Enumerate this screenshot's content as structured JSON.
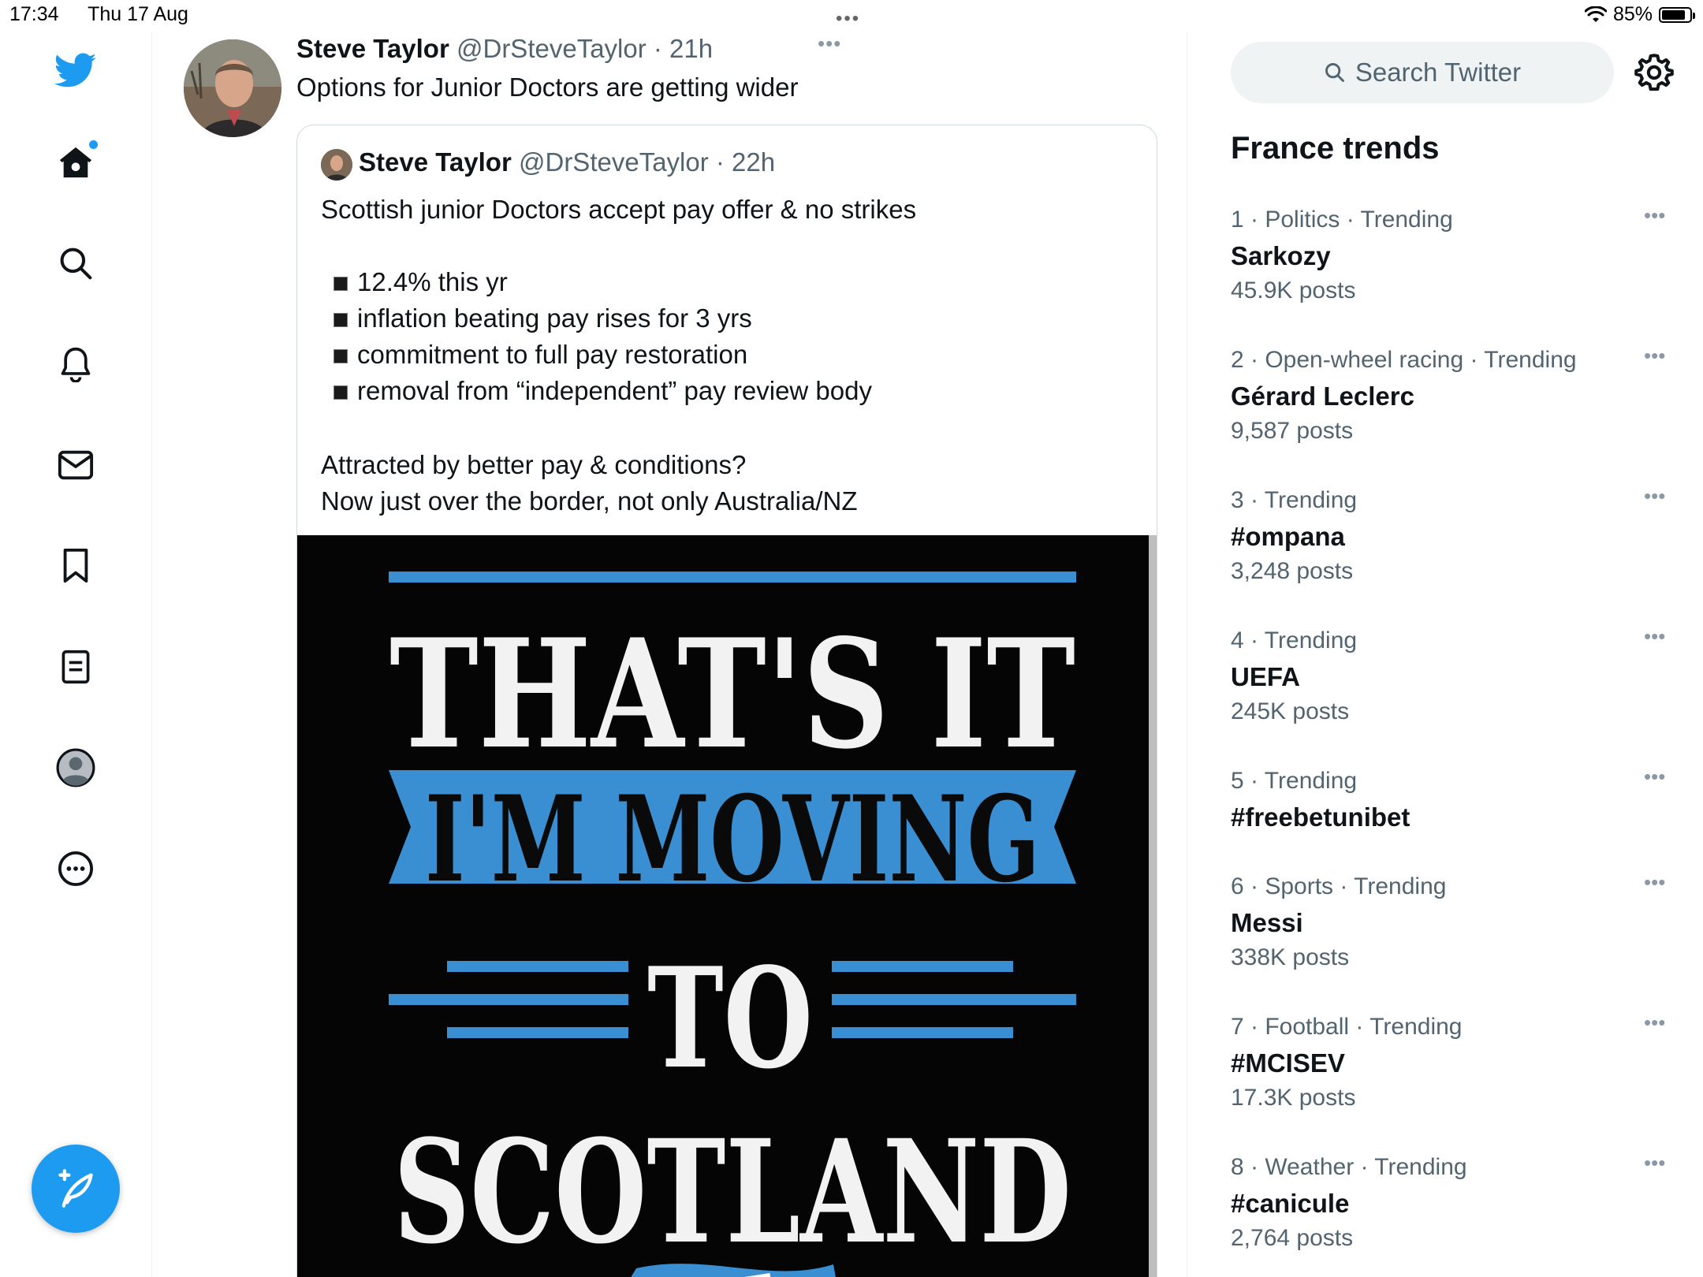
{
  "status_bar": {
    "time": "17:34",
    "date": "Thu 17 Aug",
    "battery": "85%",
    "battery_level": 0.85
  },
  "nav": {
    "items": [
      "twitter-logo",
      "home",
      "explore",
      "notifications",
      "messages",
      "bookmarks",
      "lists",
      "profile",
      "more"
    ],
    "compose_label": "Tweet"
  },
  "tweet": {
    "author_name": "Steve Taylor",
    "author_handle": "@DrSteveTaylor",
    "time_ago": "21h",
    "text": "Options for Junior Doctors are getting wider",
    "quoted": {
      "author_name": "Steve Taylor",
      "author_handle": "@DrSteveTaylor",
      "time_ago": "22h",
      "line1": "Scottish junior Doctors accept pay offer & no strikes",
      "bullets": [
        "12.4% this yr",
        "inflation beating pay rises for 3 yrs",
        "commitment to full pay restoration",
        "removal from “independent” pay review body"
      ],
      "line2": "Attracted by better pay & conditions?",
      "line3": "Now just over the border, not only Australia/NZ",
      "image_text": [
        "THAT'S IT",
        "I'M MOVING",
        "TO",
        "SCOTLAND"
      ]
    }
  },
  "sidebar": {
    "search_placeholder": "Search Twitter",
    "trends_title": "France trends",
    "trends": [
      {
        "meta": "1 · Politics · Trending",
        "name": "Sarkozy",
        "count": "45.9K posts"
      },
      {
        "meta": "2 · Open-wheel racing · Trending",
        "name": "Gérard Leclerc",
        "count": "9,587 posts"
      },
      {
        "meta": "3 · Trending",
        "name": "#ompana",
        "count": "3,248 posts"
      },
      {
        "meta": "4 · Trending",
        "name": "UEFA",
        "count": "245K posts"
      },
      {
        "meta": "5 · Trending",
        "name": "#freebetunibet",
        "count": ""
      },
      {
        "meta": "6 · Sports · Trending",
        "name": "Messi",
        "count": "338K posts"
      },
      {
        "meta": "7 · Football · Trending",
        "name": "#MCISEV",
        "count": "17.3K posts"
      },
      {
        "meta": "8 · Weather · Trending",
        "name": "#canicule",
        "count": "2,764 posts"
      }
    ]
  },
  "colors": {
    "accent": "#1d9bf0",
    "text": "#0f1419",
    "muted": "#536471",
    "poster_blue": "#3a8fd2"
  }
}
